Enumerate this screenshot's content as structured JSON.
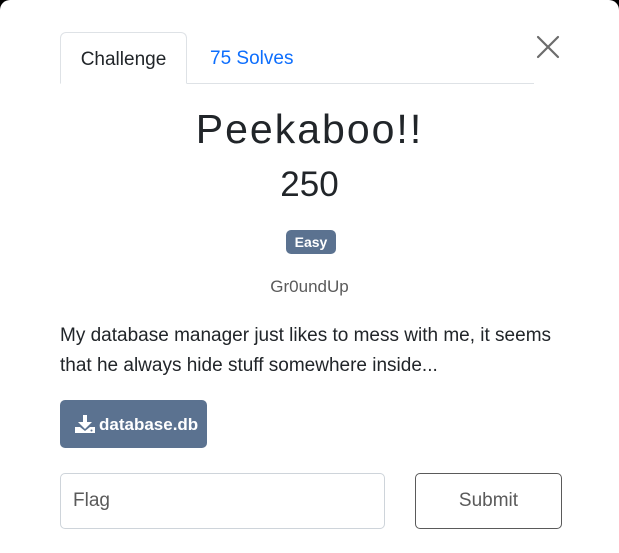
{
  "tabs": {
    "challenge_label": "Challenge",
    "solves_label": "75 Solves"
  },
  "challenge": {
    "name": "Peekaboo!!",
    "points": "250",
    "difficulty": "Easy",
    "author": "Gr0undUp",
    "description": "My database manager just likes to mess with me, it seems that he always hide stuff somewhere inside..."
  },
  "file": {
    "name": "database.db",
    "icon": "download-icon"
  },
  "flag_form": {
    "placeholder": "Flag",
    "value": "",
    "submit_label": "Submit"
  },
  "colors": {
    "accent_link": "#0d6efd",
    "badge_bg": "#5b7290",
    "button_bg": "#5b7290",
    "text": "#212529",
    "muted": "#5a5a5a"
  }
}
